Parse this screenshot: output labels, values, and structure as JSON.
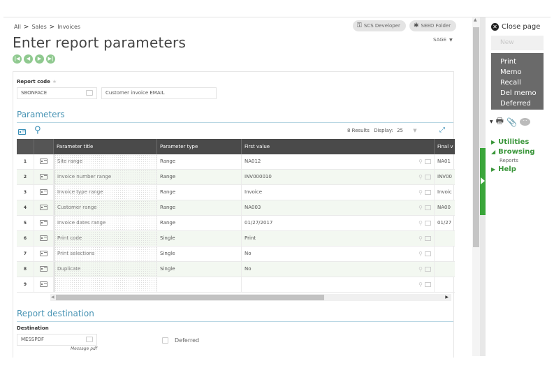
{
  "breadcrumb": [
    "All",
    "Sales",
    "Invoices"
  ],
  "page_title": "Enter report parameters",
  "nav_arrows": [
    "first-record",
    "previous-record",
    "next-record",
    "last-record"
  ],
  "header_pills": [
    {
      "label": "SCS Developer",
      "icon": "key-icon"
    },
    {
      "label": "SEED Folder",
      "icon": "plug-icon"
    }
  ],
  "folder_selector": {
    "value": "SAGE"
  },
  "report_code": {
    "label": "Report code",
    "value": "SBONFACE",
    "description": "Customer invoice EMAIL"
  },
  "parameters": {
    "section_title": "Parameters",
    "results_text": "8 Results",
    "display_label": "Display:",
    "display_value": "25",
    "columns": [
      "",
      "",
      "Parameter title",
      "Parameter type",
      "First value",
      "Final v"
    ],
    "rows": [
      {
        "num": "1",
        "title": "Site range",
        "type": "Range",
        "first": "NA012",
        "final": "NA01"
      },
      {
        "num": "2",
        "title": "Invoice number range",
        "type": "Range",
        "first": "INV000010",
        "final": "INV00"
      },
      {
        "num": "3",
        "title": "Invoice type range",
        "type": "Range",
        "first": "Invoice",
        "final": "Invoic"
      },
      {
        "num": "4",
        "title": "Customer range",
        "type": "Range",
        "first": "NA003",
        "final": "NA00"
      },
      {
        "num": "5",
        "title": "Invoice dates range",
        "type": "Range",
        "first": "01/27/2017",
        "final": "01/27"
      },
      {
        "num": "6",
        "title": "Print code",
        "type": "Single",
        "first": "Print",
        "final": ""
      },
      {
        "num": "7",
        "title": "Print selections",
        "type": "Single",
        "first": "No",
        "final": ""
      },
      {
        "num": "8",
        "title": "Duplicate",
        "type": "Single",
        "first": "No",
        "final": ""
      },
      {
        "num": "9",
        "title": "",
        "type": "",
        "first": "",
        "final": ""
      }
    ]
  },
  "report_destination": {
    "section_title": "Report destination",
    "destination_label": "Destination",
    "destination_value": "MESSPDF",
    "destination_desc": "Message pdf",
    "deferred_label": "Deferred",
    "deferred_checked": false
  },
  "right_panel": {
    "close_label": "Close page",
    "new_label": "New",
    "menu_items": [
      "Print",
      "Memo",
      "Recall",
      "Del memo",
      "Deferred"
    ],
    "tree": [
      {
        "label": "Utilities",
        "expanded": false,
        "children": []
      },
      {
        "label": "Browsing",
        "expanded": true,
        "children": [
          "Reports"
        ]
      },
      {
        "label": "Help",
        "expanded": false,
        "children": []
      }
    ]
  },
  "colors": {
    "accent_green": "#3a963a",
    "section_blue": "#4a95b5",
    "grid_header": "#4a4a4a",
    "menu_block": "#6a6a6a"
  }
}
